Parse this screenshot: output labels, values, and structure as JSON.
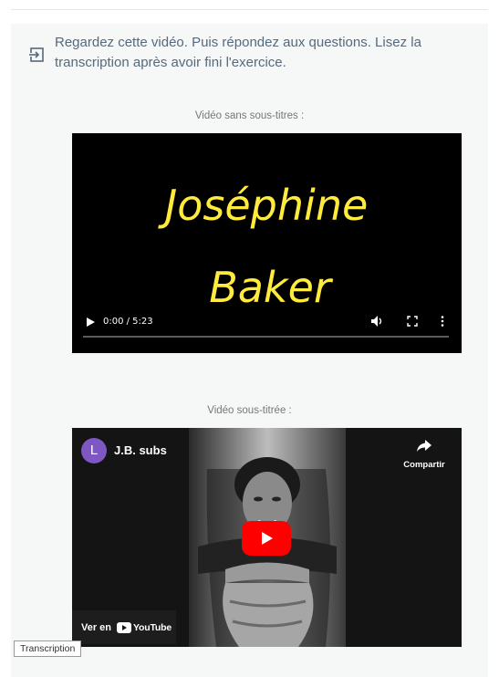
{
  "instruction": {
    "text": "Regardez cette vidéo. Puis répondez aux questions. Lisez la transcription après avoir fini l'exercice.",
    "icon": "login-arrow-icon"
  },
  "video1": {
    "caption": "Vidéo sans sous-titres :",
    "title_line1": "Joséphine",
    "title_line2": "Baker",
    "time": "0:00 / 5:23",
    "progress": 0,
    "title_color": "#ffeb3b"
  },
  "video2": {
    "caption": "Vidéo sous-titrée :",
    "channel_initial": "L",
    "channel_name": "J.B. subs",
    "share_label": "Compartir",
    "watch_on": "Ver en",
    "youtube_label": "YouTube",
    "play_color": "#ff0000",
    "avatar_color": "#7e57c2"
  },
  "transcription_button": "Transcription"
}
